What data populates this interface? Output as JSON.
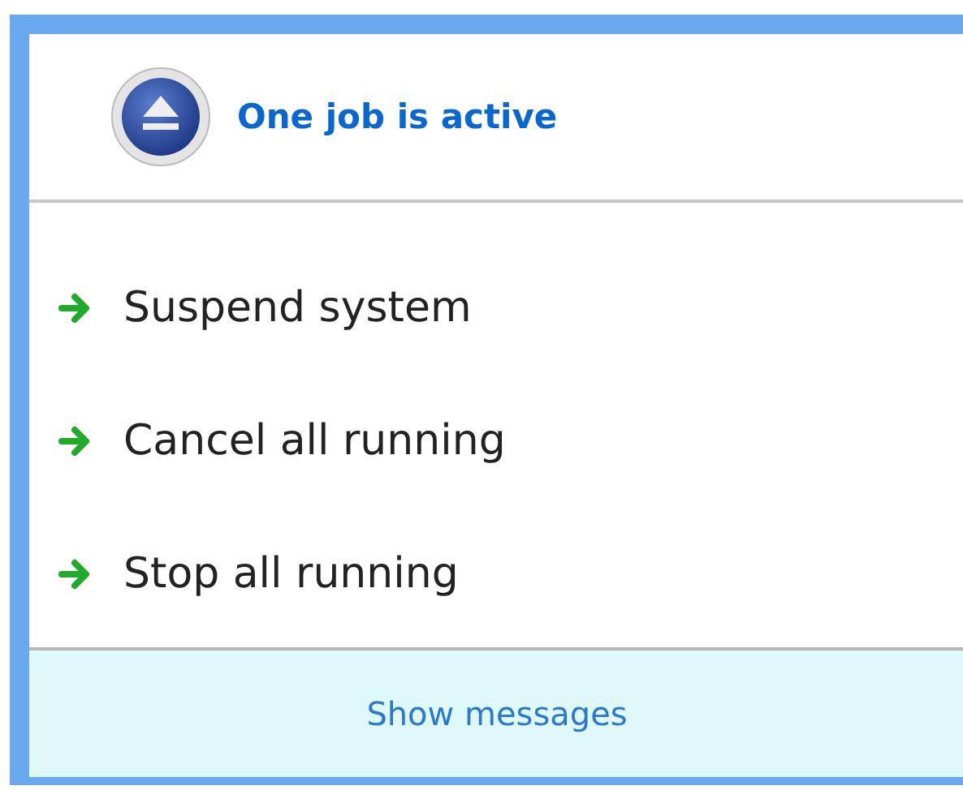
{
  "header": {
    "title": "One job is active"
  },
  "actions": [
    {
      "label": "Suspend system"
    },
    {
      "label": "Cancel all running"
    },
    {
      "label": "Stop all running"
    }
  ],
  "footer": {
    "link": "Show messages"
  }
}
